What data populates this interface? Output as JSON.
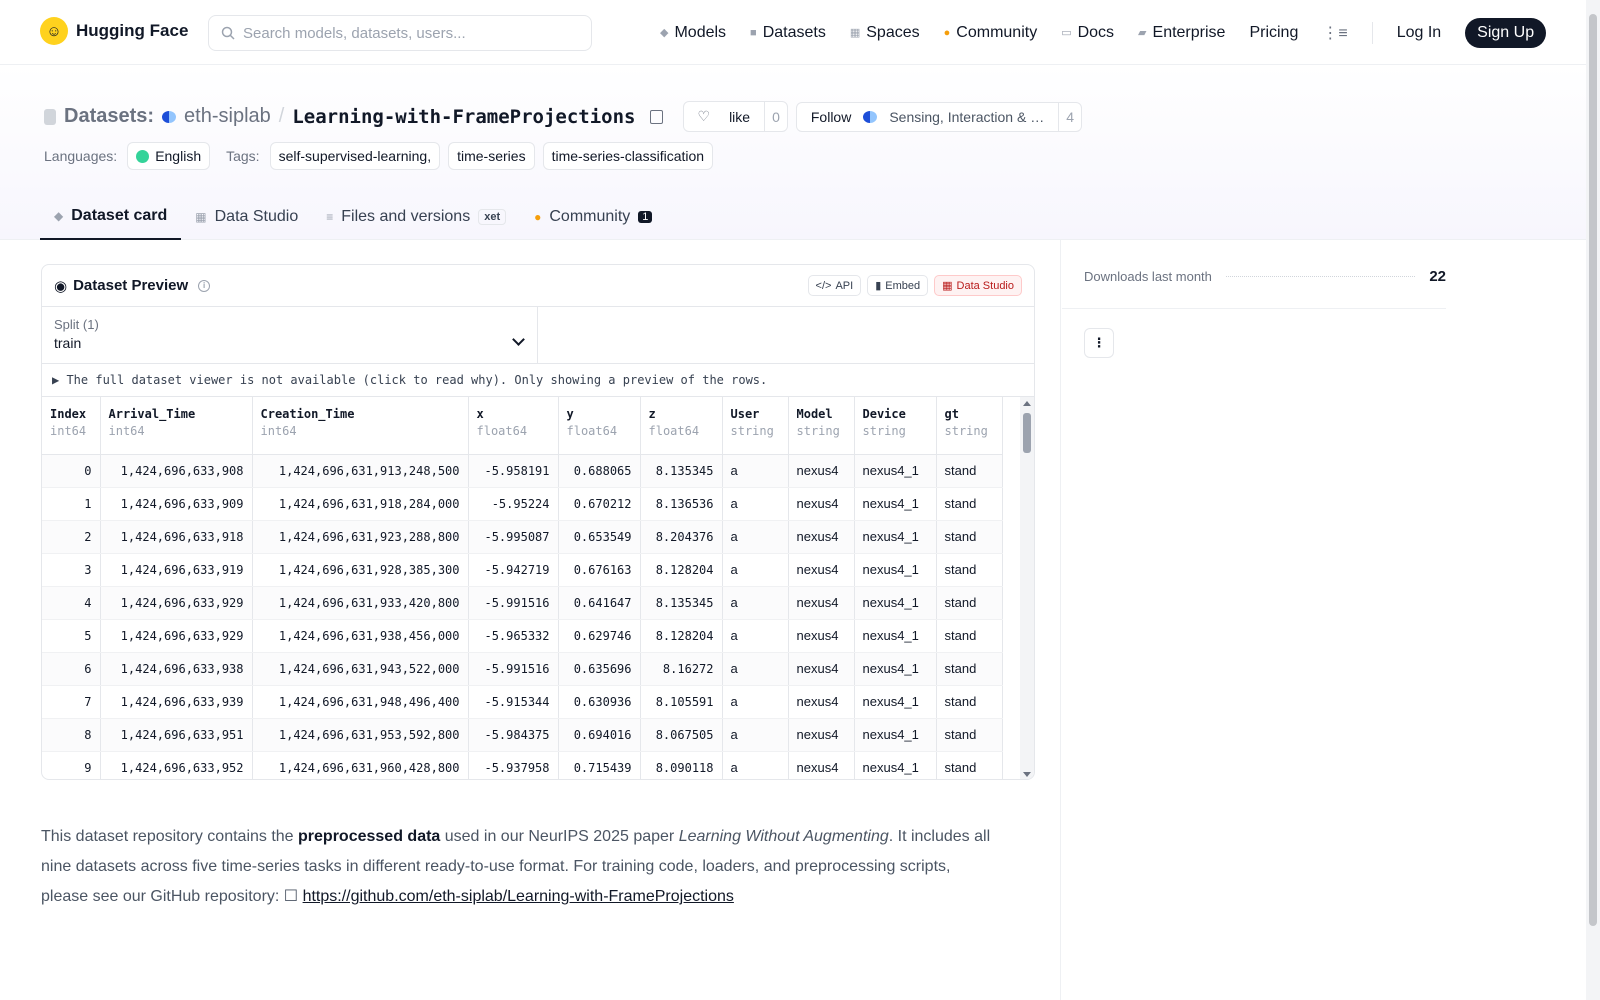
{
  "nav": {
    "brand": "Hugging Face",
    "search_placeholder": "Search models, datasets, users...",
    "items": [
      {
        "label": "Models",
        "icon": "cube-icon",
        "color": "#9ca3af"
      },
      {
        "label": "Datasets",
        "icon": "database-icon",
        "color": "#9ca3af"
      },
      {
        "label": "Spaces",
        "icon": "grid-icon",
        "color": "#9ca3af"
      },
      {
        "label": "Community",
        "icon": "hug-icon",
        "color": "#f59e0b"
      },
      {
        "label": "Docs",
        "icon": "book-icon",
        "color": "#9ca3af"
      },
      {
        "label": "Enterprise",
        "icon": "briefcase-icon",
        "color": "#9ca3af"
      }
    ],
    "pricing": "Pricing",
    "login": "Log In",
    "signup": "Sign Up"
  },
  "repo": {
    "type_label": "Datasets:",
    "org": "eth-siplab",
    "separator": "/",
    "name": "Learning-with-FrameProjections",
    "like_label": "like",
    "like_count": "0",
    "follow_label": "Follow",
    "follow_org": "Sensing, Interaction & …",
    "follow_count": "4"
  },
  "meta": {
    "languages_label": "Languages:",
    "language": "English",
    "tags_label": "Tags:",
    "tags": [
      "self-supervised-learning,",
      "time-series",
      "time-series-classification"
    ]
  },
  "tabs": [
    {
      "label": "Dataset card",
      "active": true
    },
    {
      "label": "Data Studio"
    },
    {
      "label": "Files and versions",
      "badge": "xet"
    },
    {
      "label": "Community",
      "badge": "1"
    }
  ],
  "preview": {
    "title": "Dataset Preview",
    "api_label": "API",
    "embed_label": "Embed",
    "studio_label": "Data Studio",
    "split_label": "Split (1)",
    "split_value": "train",
    "notice": "▶ The full dataset viewer is not available (click to read why). Only showing a preview of the rows.",
    "columns": [
      {
        "name": "Index",
        "type": "int64"
      },
      {
        "name": "Arrival_Time",
        "type": "int64"
      },
      {
        "name": "Creation_Time",
        "type": "int64"
      },
      {
        "name": "x",
        "type": "float64"
      },
      {
        "name": "y",
        "type": "float64"
      },
      {
        "name": "z",
        "type": "float64"
      },
      {
        "name": "User",
        "type": "string"
      },
      {
        "name": "Model",
        "type": "string"
      },
      {
        "name": "Device",
        "type": "string"
      },
      {
        "name": "gt",
        "type": "string"
      }
    ],
    "rows": [
      [
        "0",
        "1,424,696,633,908",
        "1,424,696,631,913,248,500",
        "-5.958191",
        "0.688065",
        "8.135345",
        "a",
        "nexus4",
        "nexus4_1",
        "stand"
      ],
      [
        "1",
        "1,424,696,633,909",
        "1,424,696,631,918,284,000",
        "-5.95224",
        "0.670212",
        "8.136536",
        "a",
        "nexus4",
        "nexus4_1",
        "stand"
      ],
      [
        "2",
        "1,424,696,633,918",
        "1,424,696,631,923,288,800",
        "-5.995087",
        "0.653549",
        "8.204376",
        "a",
        "nexus4",
        "nexus4_1",
        "stand"
      ],
      [
        "3",
        "1,424,696,633,919",
        "1,424,696,631,928,385,300",
        "-5.942719",
        "0.676163",
        "8.128204",
        "a",
        "nexus4",
        "nexus4_1",
        "stand"
      ],
      [
        "4",
        "1,424,696,633,929",
        "1,424,696,631,933,420,800",
        "-5.991516",
        "0.641647",
        "8.135345",
        "a",
        "nexus4",
        "nexus4_1",
        "stand"
      ],
      [
        "5",
        "1,424,696,633,929",
        "1,424,696,631,938,456,000",
        "-5.965332",
        "0.629746",
        "8.128204",
        "a",
        "nexus4",
        "nexus4_1",
        "stand"
      ],
      [
        "6",
        "1,424,696,633,938",
        "1,424,696,631,943,522,000",
        "-5.991516",
        "0.635696",
        "8.16272",
        "a",
        "nexus4",
        "nexus4_1",
        "stand"
      ],
      [
        "7",
        "1,424,696,633,939",
        "1,424,696,631,948,496,400",
        "-5.915344",
        "0.630936",
        "8.105591",
        "a",
        "nexus4",
        "nexus4_1",
        "stand"
      ],
      [
        "8",
        "1,424,696,633,951",
        "1,424,696,631,953,592,800",
        "-5.984375",
        "0.694016",
        "8.067505",
        "a",
        "nexus4",
        "nexus4_1",
        "stand"
      ],
      [
        "9",
        "1,424,696,633,952",
        "1,424,696,631,960,428,800",
        "-5.937958",
        "0.715439",
        "8.090118",
        "a",
        "nexus4",
        "nexus4_1",
        "stand"
      ]
    ]
  },
  "description": {
    "p1": "This dataset repository contains the ",
    "bold": "preprocessed data",
    "p2": " used in our NeurIPS 2025 paper ",
    "italic": "Learning Without Augmenting",
    "p3": ". It includes all nine datasets across five time-series tasks in different ready-to-use format. For training code, loaders, and preprocessing scripts, please see our GitHub repository: ☐ ",
    "link": "https://github.com/eth-siplab/Learning-with-FrameProjections"
  },
  "sidebar": {
    "downloads_label": "Downloads last month",
    "downloads_value": "22"
  }
}
